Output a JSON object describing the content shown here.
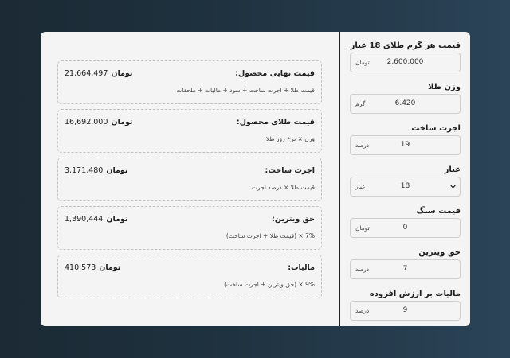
{
  "form": {
    "fields": [
      {
        "label": "قیمت هر گرم طلای 18 عیار",
        "value": "2,600,000",
        "unit": "تومان",
        "type": "input"
      },
      {
        "label": "وزن طلا",
        "value": "6.420",
        "unit": "گرم",
        "type": "input"
      },
      {
        "label": "اجرت ساخت",
        "value": "19",
        "unit": "درصد",
        "type": "input"
      },
      {
        "label": "عیار",
        "value": "18",
        "unit": "عیار",
        "type": "select"
      },
      {
        "label": "قیمت سنگ",
        "value": "0",
        "unit": "تومان",
        "type": "input"
      },
      {
        "label": "حق ویترین",
        "value": "7",
        "unit": "درصد",
        "type": "input"
      },
      {
        "label": "مالیات بر ارزش افزوده",
        "value": "9",
        "unit": "درصد",
        "type": "input"
      }
    ]
  },
  "results": [
    {
      "title": "قیمت نهایی محصول:",
      "amount": "21,664,497",
      "currency": "تومان",
      "formula": "قیمت طلا + اجرت ساخت + سود + مالیات + ملحقات"
    },
    {
      "title": "قیمت طلای محصول:",
      "amount": "16,692,000",
      "currency": "تومان",
      "formula": "وزن × نرخ روز طلا"
    },
    {
      "title": "اجرت ساخت:",
      "amount": "3,171,480",
      "currency": "تومان",
      "formula": "قیمت طلا × درصد اجرت"
    },
    {
      "title": "حق ویترین:",
      "amount": "1,390,444",
      "currency": "تومان",
      "formula": "7% × (قیمت طلا + اجرت ساخت)"
    },
    {
      "title": "مالیات:",
      "amount": "410,573",
      "currency": "تومان",
      "formula": "9% × (حق ویترین + اجرت ساخت)"
    }
  ],
  "colors": {
    "card_bg": "#f4f4f5",
    "divider": "#1f1f1f",
    "dashed_border": "#c2c2c7"
  }
}
